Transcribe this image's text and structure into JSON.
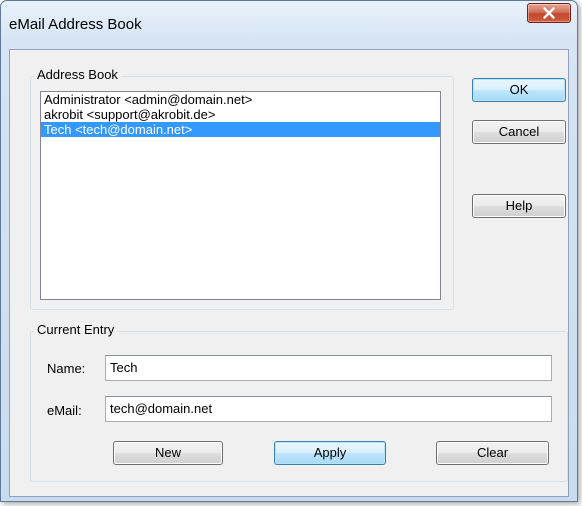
{
  "window": {
    "title": "eMail Address Book"
  },
  "address_book": {
    "group_label": "Address Book",
    "items": [
      {
        "label": "Administrator <admin@domain.net>",
        "selected": false
      },
      {
        "label": "akrobit <support@akrobit.de>",
        "selected": false
      },
      {
        "label": "Tech <tech@domain.net>",
        "selected": true
      }
    ]
  },
  "buttons": {
    "ok": "OK",
    "cancel": "Cancel",
    "help": "Help",
    "new": "New",
    "apply": "Apply",
    "clear": "Clear"
  },
  "current_entry": {
    "group_label": "Current Entry",
    "name_label": "Name:",
    "name_value": "Tech",
    "email_label": "eMail:",
    "email_value": "tech@domain.net"
  },
  "colors": {
    "selection": "#3399ff",
    "close_button": "#c0472c"
  },
  "icons": {
    "close": "close-icon"
  }
}
